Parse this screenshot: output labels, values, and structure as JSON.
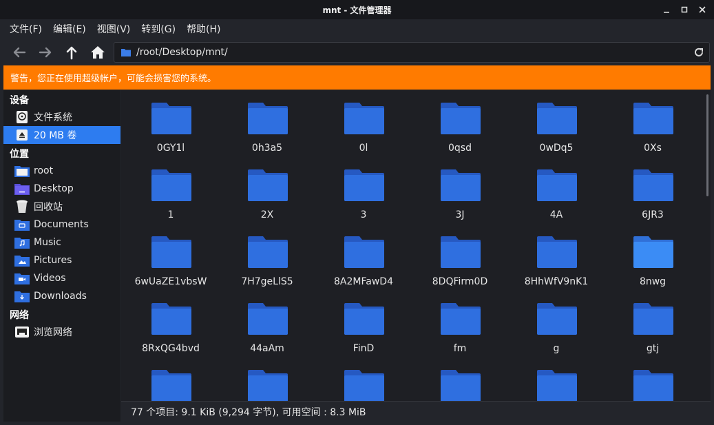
{
  "window": {
    "title": "mnt - 文件管理器"
  },
  "menu": [
    "文件(F)",
    "编辑(E)",
    "视图(V)",
    "转到(G)",
    "帮助(H)"
  ],
  "location": {
    "path": "/root/Desktop/mnt/"
  },
  "warning": {
    "text": "警告，您正在使用超级帐户，可能会损害您的系统。",
    "color": "#ff7b00"
  },
  "sidebar": {
    "devices_title": "设备",
    "devices": [
      {
        "label": "文件系统",
        "icon": "drive-icon"
      },
      {
        "label": "20 MB 卷",
        "icon": "eject-icon",
        "selected": true
      }
    ],
    "places_title": "位置",
    "places": [
      {
        "label": "root",
        "icon": "home-folder-icon"
      },
      {
        "label": "Desktop",
        "icon": "desktop-folder-icon"
      },
      {
        "label": "回收站",
        "icon": "trash-icon"
      },
      {
        "label": "Documents",
        "icon": "documents-folder-icon"
      },
      {
        "label": "Music",
        "icon": "music-folder-icon"
      },
      {
        "label": "Pictures",
        "icon": "pictures-folder-icon"
      },
      {
        "label": "Videos",
        "icon": "videos-folder-icon"
      },
      {
        "label": "Downloads",
        "icon": "downloads-folder-icon"
      }
    ],
    "network_title": "网络",
    "network": [
      {
        "label": "浏览网络",
        "icon": "network-icon"
      }
    ]
  },
  "files": [
    "0GY1l",
    "0h3a5",
    "0l",
    "0qsd",
    "0wDq5",
    "0Xs",
    "1",
    "2X",
    "3",
    "3J",
    "4A",
    "6JR3",
    "6wUaZE1vbsW",
    "7H7geLlS5",
    "8A2MFawD4",
    "8DQFirm0D",
    "8HhWfV9nK1",
    "8nwg",
    "8RxQG4bvd",
    "44aAm",
    "FinD",
    "fm",
    "g",
    "gtj",
    "",
    "",
    "",
    "",
    "",
    ""
  ],
  "status": {
    "text": "77 个项目: 9.1 KiB (9,294 字节), 可用空间 : 8.3 MiB"
  },
  "colors": {
    "accent": "#2d7cf0",
    "folder": "#2f6fe0",
    "folder_highlight": "#3b8cf5"
  }
}
